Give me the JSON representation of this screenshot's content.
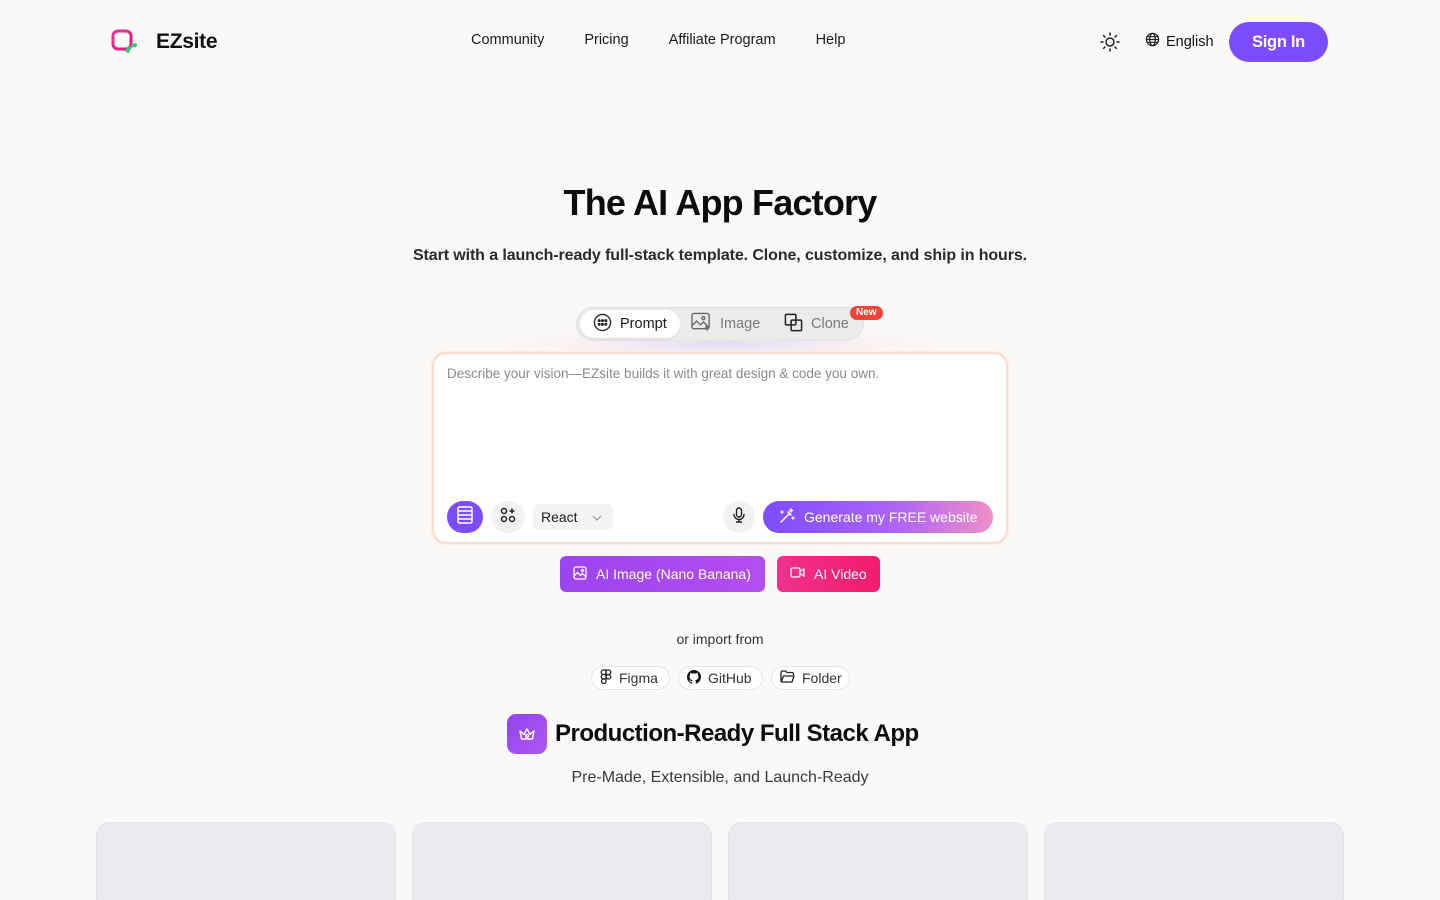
{
  "header": {
    "brand": "EZsite",
    "nav": [
      "Community",
      "Pricing",
      "Affiliate Program",
      "Help"
    ],
    "language": "English",
    "sign_in": "Sign In"
  },
  "hero": {
    "title": "The AI App Factory",
    "subtitle": "Start with a launch-ready full-stack template. Clone, customize, and ship in hours."
  },
  "modes": {
    "tabs": [
      {
        "label": "Prompt",
        "icon": "prompt-icon",
        "active": true
      },
      {
        "label": "Image",
        "icon": "image-icon",
        "active": false
      },
      {
        "label": "Clone",
        "icon": "clone-icon",
        "active": false
      }
    ],
    "new_badge": "New"
  },
  "prompt": {
    "placeholder": "Describe your vision—EZsite builds it with great design & code you own.",
    "framework": "React",
    "generate": "Generate my FREE website"
  },
  "ai_buttons": {
    "image": "AI Image (Nano Banana)",
    "video": "AI Video"
  },
  "import": {
    "label": "or import from",
    "sources": [
      "Figma",
      "GitHub",
      "Folder"
    ]
  },
  "section": {
    "title": "Production-Ready Full Stack App",
    "subtitle": "Pre-Made, Extensible, and Launch-Ready"
  },
  "colors": {
    "accent": "#7c4dff",
    "background": "#faf9f8",
    "ai_image": "#9b44f0",
    "ai_video": "#f21c6d",
    "badge": "#f04438"
  }
}
